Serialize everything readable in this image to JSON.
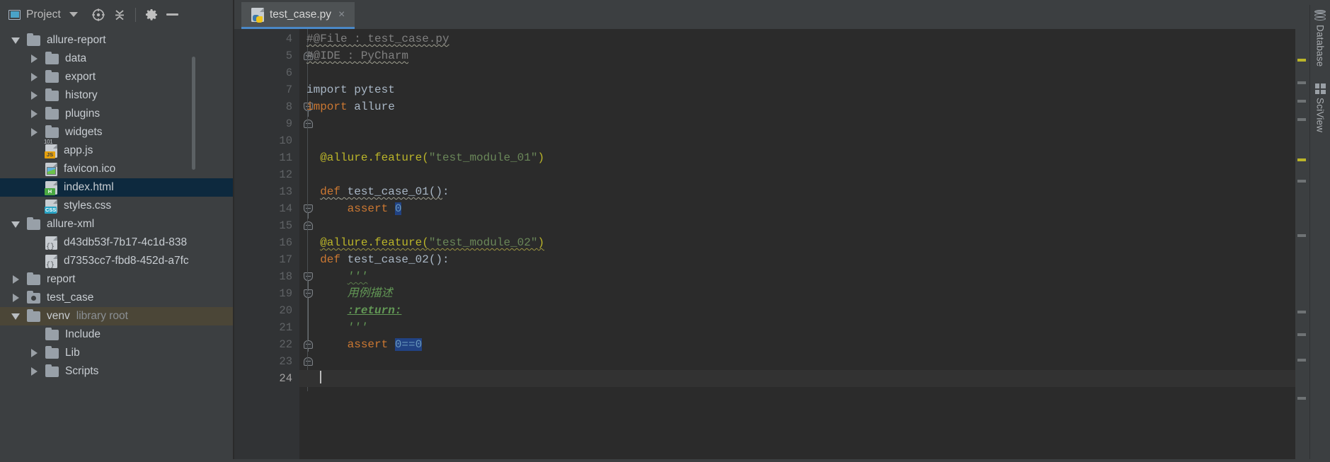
{
  "window": {
    "theme_bg": "#3c3f41",
    "editor_bg": "#2b2b2b",
    "accent": "#4a88c7"
  },
  "project_panel": {
    "toolbar": {
      "title": "Project",
      "dropdown_icon": "chevron-down-icon",
      "locate_icon": "crosshair-target-icon",
      "collapse_icon": "collapse-all-icon",
      "settings_icon": "gear-icon",
      "hide_icon": "minimize-icon"
    },
    "tree": [
      {
        "label": "allure-report",
        "type": "folder",
        "depth": 1,
        "state": "open",
        "selected": false
      },
      {
        "label": "data",
        "type": "folder",
        "depth": 2,
        "state": "closed",
        "selected": false
      },
      {
        "label": "export",
        "type": "folder",
        "depth": 2,
        "state": "closed",
        "selected": false
      },
      {
        "label": "history",
        "type": "folder",
        "depth": 2,
        "state": "closed",
        "selected": false
      },
      {
        "label": "plugins",
        "type": "folder",
        "depth": 2,
        "state": "closed",
        "selected": false
      },
      {
        "label": "widgets",
        "type": "folder",
        "depth": 2,
        "state": "closed",
        "selected": false
      },
      {
        "label": "app.js",
        "type": "file-js",
        "depth": 2,
        "state": "none",
        "selected": false
      },
      {
        "label": "favicon.ico",
        "type": "file-image",
        "depth": 2,
        "state": "none",
        "selected": false
      },
      {
        "label": "index.html",
        "type": "file-html",
        "depth": 2,
        "state": "none",
        "selected": true
      },
      {
        "label": "styles.css",
        "type": "file-css",
        "depth": 2,
        "state": "none",
        "selected": false
      },
      {
        "label": "allure-xml",
        "type": "folder",
        "depth": 1,
        "state": "open",
        "selected": false
      },
      {
        "label": "d43db53f-7b17-4c1d-838",
        "type": "file-xml",
        "depth": 2,
        "state": "none",
        "selected": false
      },
      {
        "label": "d7353cc7-fbd8-452d-a7fc",
        "type": "file-xml",
        "depth": 2,
        "state": "none",
        "selected": false
      },
      {
        "label": "report",
        "type": "folder",
        "depth": 1,
        "state": "closed",
        "selected": false
      },
      {
        "label": "test_case",
        "type": "folder-source",
        "depth": 1,
        "state": "closed",
        "selected": false
      },
      {
        "label": "venv",
        "type": "folder",
        "depth": 1,
        "state": "open",
        "selected": false,
        "suffix": "library root",
        "highlight": true
      },
      {
        "label": "Include",
        "type": "folder",
        "depth": 2,
        "state": "none",
        "selected": false
      },
      {
        "label": "Lib",
        "type": "folder",
        "depth": 2,
        "state": "closed",
        "selected": false
      },
      {
        "label": "Scripts",
        "type": "folder",
        "depth": 2,
        "state": "closed",
        "selected": false
      }
    ]
  },
  "editor": {
    "tab": {
      "title": "test_case.py",
      "icon": "python-file-icon",
      "close_label": "×",
      "active": true
    },
    "first_line_number": 4,
    "lines": [
      {
        "n": 4,
        "text": "#@File : test_case.py"
      },
      {
        "n": 5,
        "text": "#@IDE : PyCharm"
      },
      {
        "n": 6,
        "text": ""
      },
      {
        "n": 7,
        "text": "import pytest"
      },
      {
        "n": 8,
        "text": "import allure"
      },
      {
        "n": 9,
        "text": ""
      },
      {
        "n": 10,
        "text": ""
      },
      {
        "n": 11,
        "text": "@allure.feature(\"test_module_01\")"
      },
      {
        "n": 12,
        "text": ""
      },
      {
        "n": 13,
        "text": "def test_case_01():"
      },
      {
        "n": 14,
        "text": "    assert 0"
      },
      {
        "n": 15,
        "text": ""
      },
      {
        "n": 16,
        "text": "@allure.feature(\"test_module_02\")"
      },
      {
        "n": 17,
        "text": "def test_case_02():"
      },
      {
        "n": 18,
        "text": "    '''"
      },
      {
        "n": 19,
        "text": "    用例描述"
      },
      {
        "n": 20,
        "text": "    :return:"
      },
      {
        "n": 21,
        "text": "    '''"
      },
      {
        "n": 22,
        "text": "    assert 0==0"
      },
      {
        "n": 23,
        "text": ""
      },
      {
        "n": 24,
        "text": ""
      }
    ],
    "tokens": {
      "comment_file": "#@File : test_case.py",
      "comment_ide": "#@IDE : PyCharm",
      "kw_import": "import",
      "mod_pytest": " pytest",
      "mod_allure": " allure",
      "deco_feature": "@allure.feature(",
      "str_module_01": "\"test_module_01\"",
      "str_module_02": "\"test_module_02\"",
      "deco_close": ")",
      "kw_def": "def",
      "fn_case_01": " test_case_01()",
      "fn_case_02": " test_case_02()",
      "colon": ":",
      "kw_assert": "assert",
      "num_zero": "0",
      "assert_eq": "0==0",
      "docquote": "'''",
      "doc_text": "用例描述",
      "doc_tag": ":return:"
    },
    "caret_line": 24
  },
  "right_tool_bar": {
    "items": [
      {
        "label": "Database",
        "icon": "database-icon"
      },
      {
        "label": "SciView",
        "icon": "grid-chart-icon"
      }
    ]
  }
}
